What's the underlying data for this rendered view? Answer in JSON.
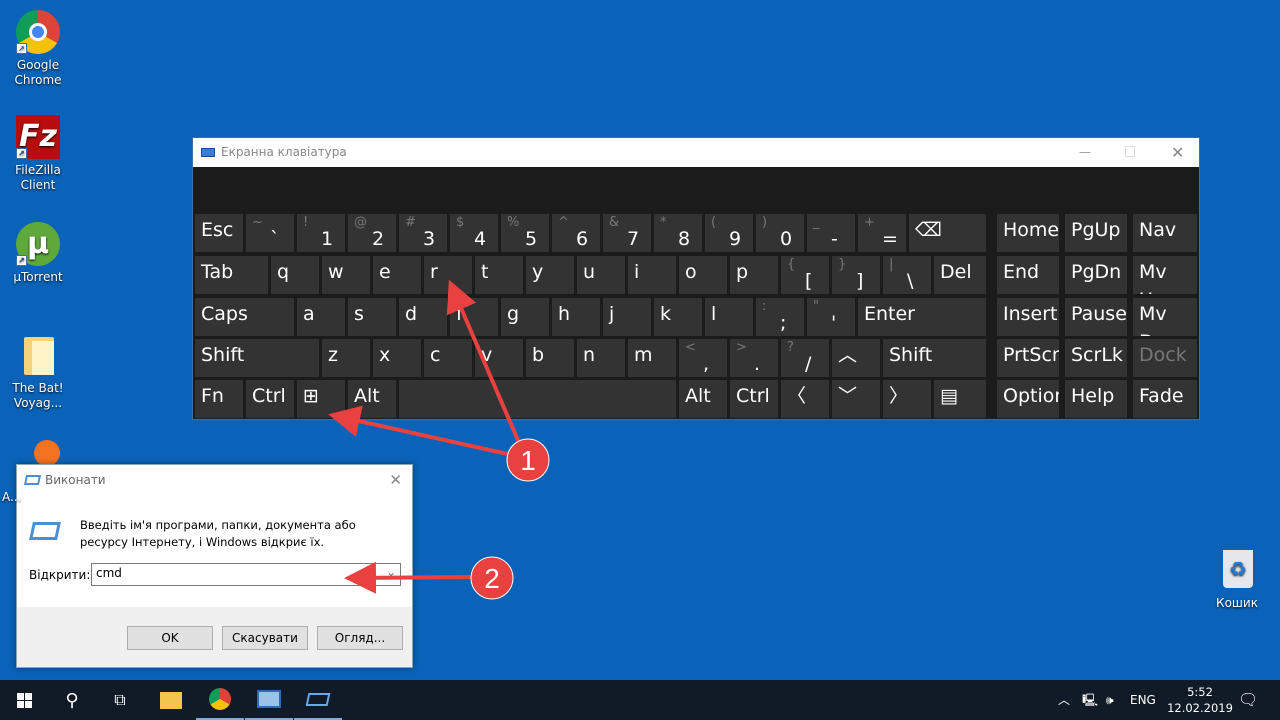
{
  "desktop": {
    "icons": [
      {
        "label": "Google Chrome",
        "name": "chrome"
      },
      {
        "label": "FileZilla Client",
        "name": "filezilla"
      },
      {
        "label": "µTorrent",
        "name": "utorrent"
      },
      {
        "label": "The Bat! Voyag...",
        "name": "folder"
      },
      {
        "label": "A...",
        "name": "avast"
      }
    ],
    "recycle_bin": "Кошик"
  },
  "osk": {
    "title": "Екранна клавіатура",
    "rows": [
      [
        {
          "k": "Esc"
        },
        {
          "k": "`",
          "s": "~"
        },
        {
          "k": "1",
          "s": "!"
        },
        {
          "k": "2",
          "s": "@"
        },
        {
          "k": "3",
          "s": "#"
        },
        {
          "k": "4",
          "s": "$"
        },
        {
          "k": "5",
          "s": "%"
        },
        {
          "k": "6",
          "s": "^"
        },
        {
          "k": "7",
          "s": "&"
        },
        {
          "k": "8",
          "s": "*"
        },
        {
          "k": "9",
          "s": "("
        },
        {
          "k": "0",
          "s": ")"
        },
        {
          "k": "-",
          "s": "_"
        },
        {
          "k": "=",
          "s": "+"
        },
        {
          "k": "⌫"
        }
      ],
      [
        {
          "k": "Tab"
        },
        {
          "k": "q"
        },
        {
          "k": "w"
        },
        {
          "k": "e"
        },
        {
          "k": "r"
        },
        {
          "k": "t"
        },
        {
          "k": "y"
        },
        {
          "k": "u"
        },
        {
          "k": "i"
        },
        {
          "k": "o"
        },
        {
          "k": "p"
        },
        {
          "k": "[",
          "s": "{"
        },
        {
          "k": "]",
          "s": "}"
        },
        {
          "k": "\\",
          "s": "|"
        },
        {
          "k": "Del"
        }
      ],
      [
        {
          "k": "Caps"
        },
        {
          "k": "a"
        },
        {
          "k": "s"
        },
        {
          "k": "d"
        },
        {
          "k": "f"
        },
        {
          "k": "g"
        },
        {
          "k": "h"
        },
        {
          "k": "j"
        },
        {
          "k": "k"
        },
        {
          "k": "l"
        },
        {
          "k": ";",
          "s": ":"
        },
        {
          "k": "'",
          "s": "\""
        },
        {
          "k": "Enter"
        }
      ],
      [
        {
          "k": "Shift"
        },
        {
          "k": "z"
        },
        {
          "k": "x"
        },
        {
          "k": "c"
        },
        {
          "k": "v"
        },
        {
          "k": "b"
        },
        {
          "k": "n"
        },
        {
          "k": "m"
        },
        {
          "k": ",",
          "s": "<"
        },
        {
          "k": ".",
          "s": ">"
        },
        {
          "k": "/",
          "s": "?"
        },
        {
          "k": "︿"
        },
        {
          "k": "Shift"
        }
      ],
      [
        {
          "k": "Fn"
        },
        {
          "k": "Ctrl"
        },
        {
          "k": "⊞"
        },
        {
          "k": "Alt"
        },
        {
          "k": ""
        },
        {
          "k": "Alt"
        },
        {
          "k": "Ctrl"
        },
        {
          "k": "〈"
        },
        {
          "k": "﹀"
        },
        {
          "k": "〉"
        },
        {
          "k": "▤"
        }
      ]
    ],
    "nav": [
      [
        "Home",
        "PgUp",
        "Nav"
      ],
      [
        "End",
        "PgDn",
        "Mv Up"
      ],
      [
        "Insert",
        "Pause",
        "Mv Dn"
      ],
      [
        "PrtScn",
        "ScrLk",
        "Dock"
      ],
      [
        "Options",
        "Help",
        "Fade"
      ]
    ]
  },
  "run": {
    "title": "Виконати",
    "description": "Введіть ім'я програми, папки, документа або ресурсу Інтернету, і Windows відкриє їх.",
    "open_label": "Відкрити:",
    "input_value": "cmd",
    "ok": "OK",
    "cancel": "Скасувати",
    "browse": "Огляд..."
  },
  "annotations": {
    "one": "1",
    "two": "2",
    "color": "#e8413f"
  },
  "taskbar": {
    "lang": "ENG",
    "time": "5:52",
    "date": "12.02.2019"
  }
}
